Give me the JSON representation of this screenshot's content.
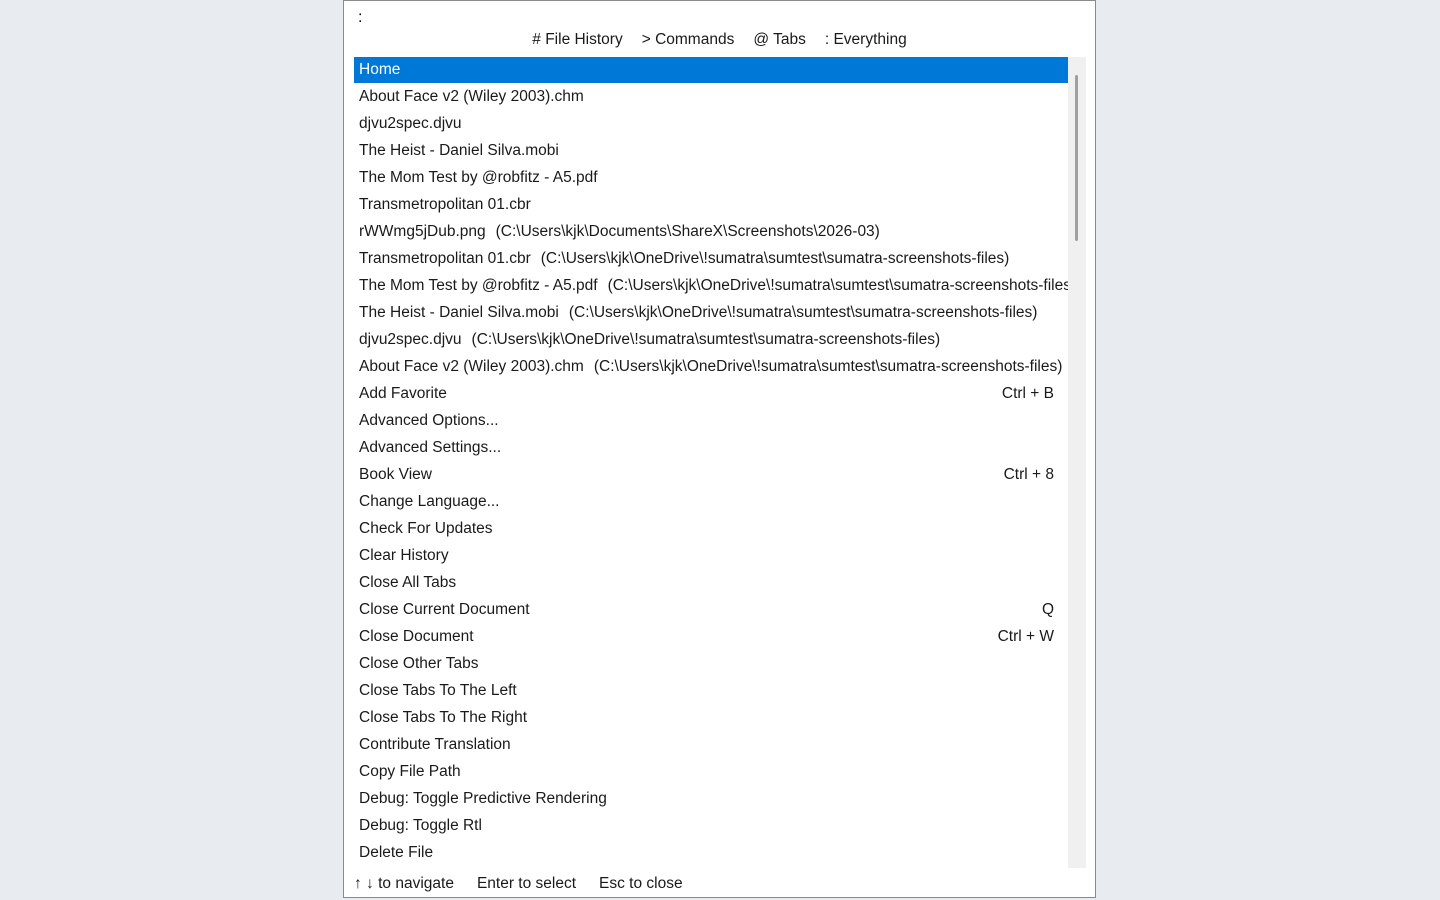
{
  "query": {
    "value": ":",
    "placeholder": ""
  },
  "filters": [
    "# File History",
    "> Commands",
    "@ Tabs",
    ": Everything"
  ],
  "items": [
    {
      "label": "Home",
      "path": "",
      "shortcut": "",
      "selected": true
    },
    {
      "label": "About Face v2 (Wiley 2003).chm",
      "path": "",
      "shortcut": ""
    },
    {
      "label": "djvu2spec.djvu",
      "path": "",
      "shortcut": ""
    },
    {
      "label": "The Heist - Daniel Silva.mobi",
      "path": "",
      "shortcut": ""
    },
    {
      "label": "The Mom Test by @robfitz - A5.pdf",
      "path": "",
      "shortcut": ""
    },
    {
      "label": "Transmetropolitan 01.cbr",
      "path": "",
      "shortcut": ""
    },
    {
      "label": "rWWmg5jDub.png",
      "path": "(C:\\Users\\kjk\\Documents\\ShareX\\Screenshots\\2026-03)",
      "shortcut": ""
    },
    {
      "label": "Transmetropolitan 01.cbr",
      "path": "(C:\\Users\\kjk\\OneDrive\\!sumatra\\sumtest\\sumatra-screenshots-files)",
      "shortcut": ""
    },
    {
      "label": "The Mom Test by @robfitz - A5.pdf",
      "path": "(C:\\Users\\kjk\\OneDrive\\!sumatra\\sumtest\\sumatra-screenshots-files)",
      "shortcut": ""
    },
    {
      "label": "The Heist - Daniel Silva.mobi",
      "path": "(C:\\Users\\kjk\\OneDrive\\!sumatra\\sumtest\\sumatra-screenshots-files)",
      "shortcut": ""
    },
    {
      "label": "djvu2spec.djvu",
      "path": "(C:\\Users\\kjk\\OneDrive\\!sumatra\\sumtest\\sumatra-screenshots-files)",
      "shortcut": ""
    },
    {
      "label": "About Face v2 (Wiley 2003).chm",
      "path": "(C:\\Users\\kjk\\OneDrive\\!sumatra\\sumtest\\sumatra-screenshots-files)",
      "shortcut": ""
    },
    {
      "label": "Add Favorite",
      "path": "",
      "shortcut": "Ctrl + B"
    },
    {
      "label": "Advanced Options...",
      "path": "",
      "shortcut": ""
    },
    {
      "label": "Advanced Settings...",
      "path": "",
      "shortcut": ""
    },
    {
      "label": "Book View",
      "path": "",
      "shortcut": "Ctrl + 8"
    },
    {
      "label": "Change Language...",
      "path": "",
      "shortcut": ""
    },
    {
      "label": "Check For Updates",
      "path": "",
      "shortcut": ""
    },
    {
      "label": "Clear History",
      "path": "",
      "shortcut": ""
    },
    {
      "label": "Close All Tabs",
      "path": "",
      "shortcut": ""
    },
    {
      "label": "Close Current Document",
      "path": "",
      "shortcut": "Q"
    },
    {
      "label": "Close Document",
      "path": "",
      "shortcut": "Ctrl + W"
    },
    {
      "label": "Close Other Tabs",
      "path": "",
      "shortcut": ""
    },
    {
      "label": "Close Tabs To The Left",
      "path": "",
      "shortcut": ""
    },
    {
      "label": "Close Tabs To The Right",
      "path": "",
      "shortcut": ""
    },
    {
      "label": "Contribute Translation",
      "path": "",
      "shortcut": ""
    },
    {
      "label": "Copy File Path",
      "path": "",
      "shortcut": ""
    },
    {
      "label": "Debug: Toggle Predictive Rendering",
      "path": "",
      "shortcut": ""
    },
    {
      "label": "Debug: Toggle Rtl",
      "path": "",
      "shortcut": ""
    },
    {
      "label": "Delete File",
      "path": "",
      "shortcut": ""
    }
  ],
  "footer": [
    "↑ ↓ to navigate",
    "Enter to select",
    "Esc to close"
  ],
  "colors": {
    "selection": "#0078d7",
    "background": "#e8ecf0"
  }
}
